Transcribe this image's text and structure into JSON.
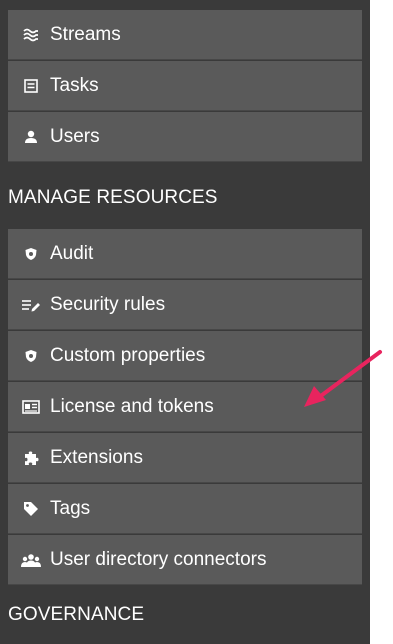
{
  "nav": {
    "items_top": [
      {
        "label": "Streams",
        "icon": "streams-icon"
      },
      {
        "label": "Tasks",
        "icon": "tasks-icon"
      },
      {
        "label": "Users",
        "icon": "user-icon"
      }
    ],
    "section_manage": "MANAGE RESOURCES",
    "items_manage": [
      {
        "label": "Audit",
        "icon": "audit-shield-icon"
      },
      {
        "label": "Security rules",
        "icon": "security-rules-icon"
      },
      {
        "label": "Custom properties",
        "icon": "custom-properties-icon"
      },
      {
        "label": "License and tokens",
        "icon": "license-card-icon"
      },
      {
        "label": "Extensions",
        "icon": "puzzle-icon"
      },
      {
        "label": "Tags",
        "icon": "tag-icon"
      },
      {
        "label": "User directory connectors",
        "icon": "user-group-icon"
      }
    ],
    "section_governance": "GOVERNANCE"
  },
  "colors": {
    "panel_bg": "#3a3a3a",
    "item_bg": "#5a5a5a",
    "text": "#ffffff",
    "arrow": "#e8245e"
  }
}
